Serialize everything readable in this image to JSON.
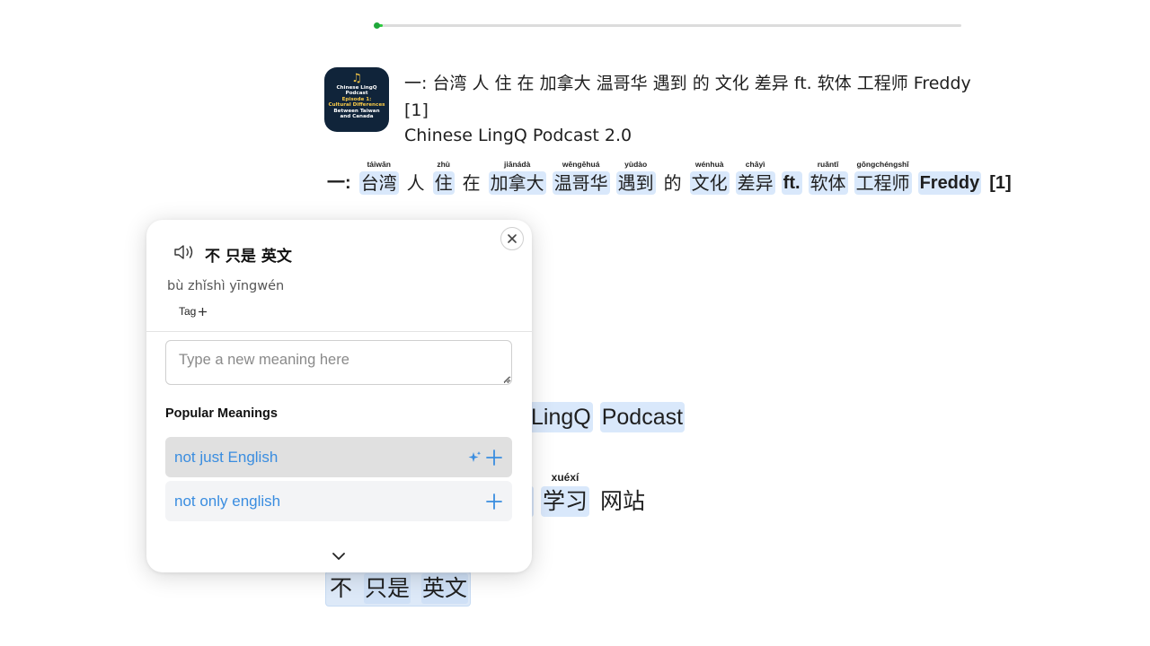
{
  "progress": {
    "fraction": 0.012,
    "fill_color": "#2ecc40"
  },
  "lesson": {
    "title": "一: 台湾 人 住 在 加拿大 温哥华 遇到 的 文化 差异 ft. 软体 工程师 Freddy [1]",
    "course": "Chinese LingQ Podcast 2.0",
    "cover": {
      "line1": "Chinese LingQ Podcast",
      "line2": "Episode 1:",
      "line3": "Cultural Differences",
      "line4": "Between Taiwan",
      "line5": "and Canada"
    }
  },
  "reader": {
    "line1": {
      "prefix": "一:",
      "tokens": [
        {
          "py": "táiwān",
          "w": "台湾",
          "hl": true
        },
        {
          "py": "",
          "w": "人",
          "hl": false
        },
        {
          "py": "zhù",
          "w": "住",
          "hl": true
        },
        {
          "py": "",
          "w": "在",
          "hl": false
        },
        {
          "py": "jiānádà",
          "w": "加拿大",
          "hl": true
        },
        {
          "py": "wēngēhuá",
          "w": "温哥华",
          "hl": true
        },
        {
          "py": "yùdào",
          "w": "遇到",
          "hl": true
        },
        {
          "py": "",
          "w": "的",
          "hl": false
        },
        {
          "py": "wénhuà",
          "w": "文化",
          "hl": true
        },
        {
          "py": "chāyì",
          "w": "差异",
          "hl": true
        },
        {
          "py": "",
          "w": "ft.",
          "hl": true,
          "latin": true
        },
        {
          "py": "ruǎntǐ",
          "w": "软体",
          "hl": true
        },
        {
          "py": "gōngchéngshī",
          "w": "工程师",
          "hl": true
        },
        {
          "py": "",
          "w": "Freddy",
          "hl": true,
          "latin": true
        },
        {
          "py": "",
          "w": "[1]",
          "hl": false,
          "latin": true
        }
      ]
    },
    "line2": {
      "w1": "LingQ",
      "w2": "Podcast"
    },
    "line3": {
      "py": "xuéxí",
      "w1": "学习",
      "w2": "网站"
    },
    "line4": {
      "w1": "不",
      "w2": "只是",
      "w3": "英文"
    }
  },
  "popup": {
    "term": "不 只是 英文",
    "pinyin": "bù zhǐshì yīngwén",
    "tag_label": "Tag",
    "input_placeholder": "Type a new meaning here",
    "input_value": "",
    "heading": "Popular Meanings",
    "meanings": [
      {
        "text": "not just English",
        "ai_suggested": true
      },
      {
        "text": "not only english",
        "ai_suggested": false
      }
    ],
    "accent_color": "#3a8de0"
  }
}
